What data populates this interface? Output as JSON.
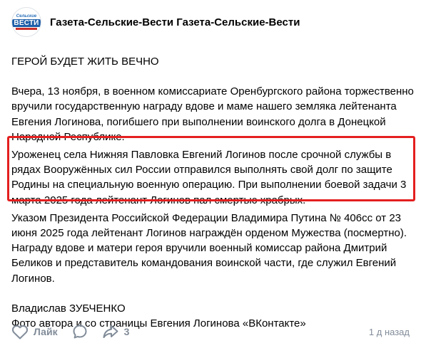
{
  "header": {
    "author": "Газета-Сельские-Вести Газета-Сельские-Вести",
    "avatar": {
      "top": "Сельские",
      "main": "ВЕСТИ"
    }
  },
  "post": {
    "title": "ГЕРОЙ БУДЕТ ЖИТЬ ВЕЧНО",
    "paragraph1": "Вчера, 13 ноября, в военном комиссариате Оренбургского района торжественно вручили государственную награду вдове и маме нашего земляка лейтенанта Евгения Логинова, погибшего при выполнении воинского долга в Донецкой Народной Республике.",
    "paragraph2": "Уроженец села Нижняя Павловка Евгений Логинов после срочной службы в рядах Вооружённых сил России отправился выполнять свой долг по защите Родины на специальную военную операцию. При выполнении боевой задачи 3 марта 2025 года лейтенант Логинов пал смертью храбрых.",
    "paragraph3": "Указом Президента Российской Федерации Владимира Путина № 406сс от 23 июня 2025 года лейтенант Логинов награждён орденом Мужества (посмертно). Награду вдове и матери героя вручили военный комиссар района Дмитрий Беликов и представитель командования воинской части, где служил Евгений Логинов.",
    "signature": "Владислав ЗУБЧЕНКО",
    "photo_credit": "Фото автора и со страницы Евгения Логинова «ВКонтакте»"
  },
  "footer": {
    "like_label": "Лайк",
    "share_count": "3",
    "time": "1 д назад"
  },
  "colors": {
    "highlight_border": "#e41f1f",
    "icon_gray": "#818c99"
  }
}
